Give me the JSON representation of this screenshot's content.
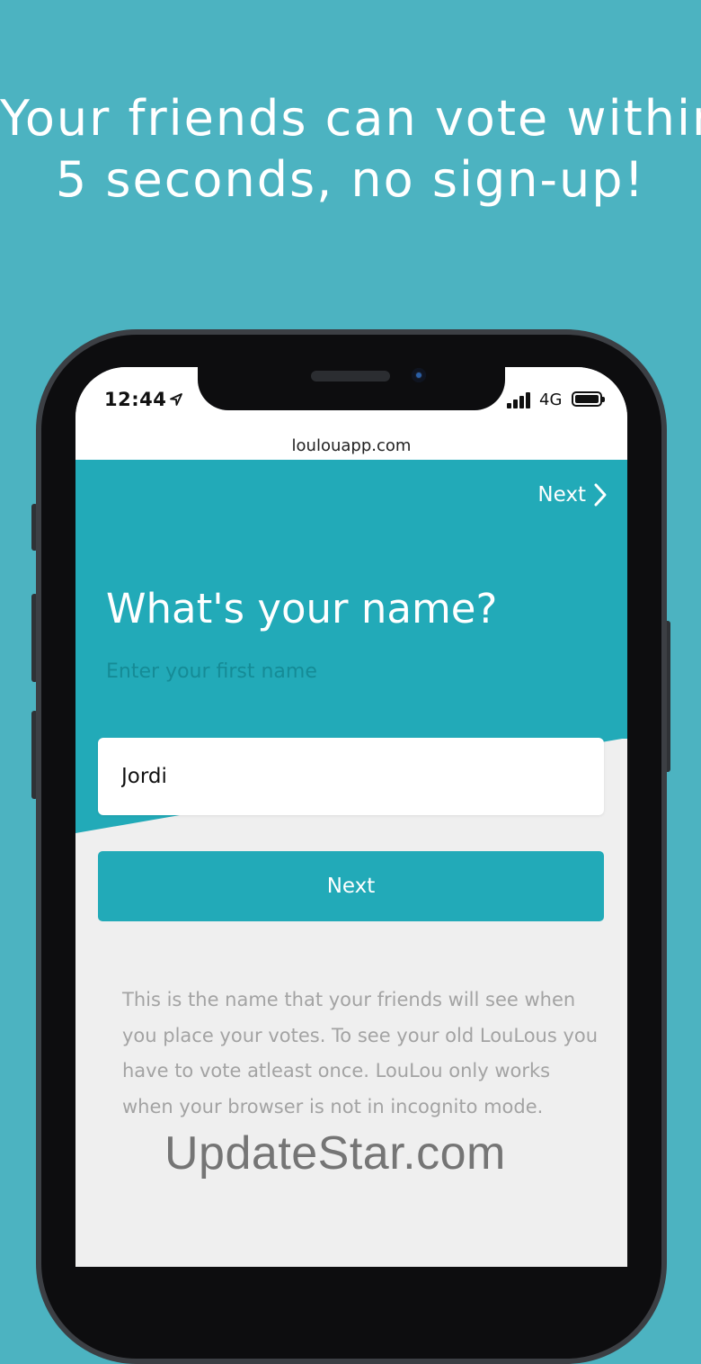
{
  "headline": {
    "line1": "Your friends can vote within",
    "line2": "5 seconds, no sign-up!"
  },
  "status_bar": {
    "time": "12:44",
    "network": "4G",
    "icons": [
      "location-arrow-icon",
      "signal-bars-icon",
      "battery-icon"
    ]
  },
  "browser": {
    "url": "loulouapp.com"
  },
  "form": {
    "top_next_label": "Next",
    "title": "What's your name?",
    "subtitle": "Enter your first name",
    "name_value": "Jordi",
    "next_button_label": "Next",
    "info_text": "This is the name that your friends will see when you place your votes. To see your old LouLous you have to vote atleast once. LouLou only works when your browser is not in incognito mode."
  },
  "watermark": "UpdateStar.com",
  "colors": {
    "background": "#4cb3c1",
    "accent": "#22aab8",
    "subtitle": "#158b96",
    "info_text": "#a3a3a3"
  }
}
